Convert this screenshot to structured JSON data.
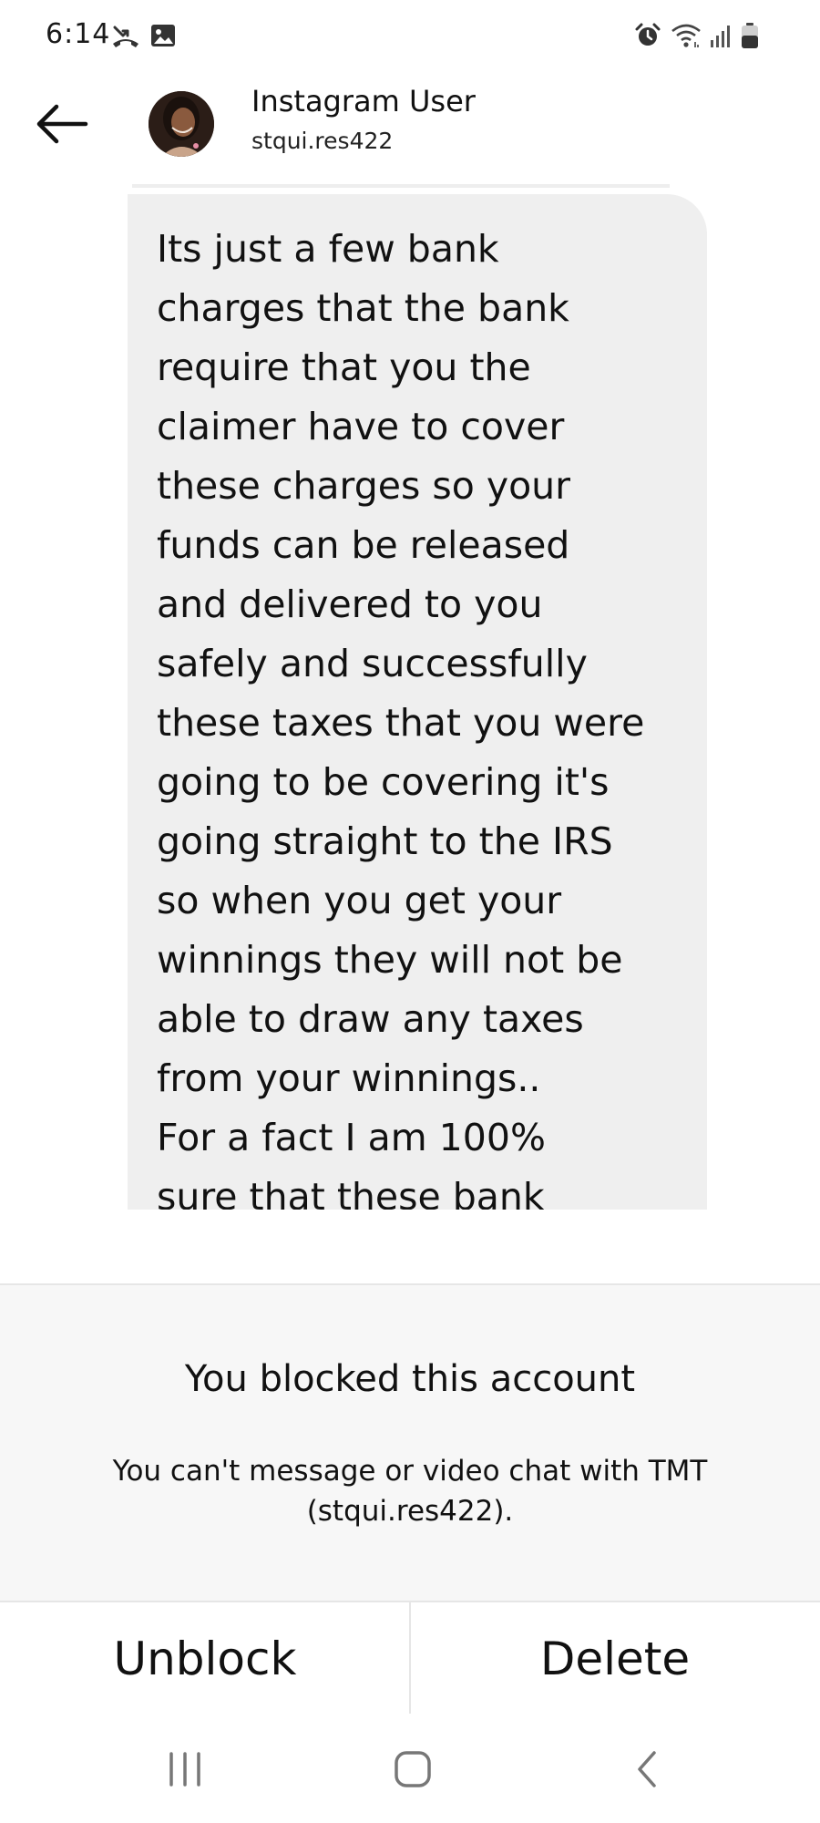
{
  "status_bar": {
    "time": "6:14",
    "icons": [
      "missed-call-icon",
      "gallery-icon",
      "alarm-icon",
      "wifi-icon",
      "signal-icon",
      "battery-icon"
    ]
  },
  "header": {
    "name": "Instagram User",
    "handle": "stqui.res422",
    "back_icon": "arrow-left-icon",
    "avatar": "profile-photo"
  },
  "message": {
    "text": "Its just a few bank\ncharges that the bank\nrequire that you the\nclaimer have to cover\nthese charges so your\nfunds can be released\nand delivered to you\nsafely and successfully\nthese taxes that you were\ngoing to be covering it's\ngoing straight to the IRS\nso when you get your\nwinnings they will not be\nable to draw any taxes\nfrom your winnings..\nFor a fact I am 100%\nsure that these bank"
  },
  "blocked": {
    "title": "You blocked this account",
    "description": "You can't message or video chat with TMT (stqui.res422)."
  },
  "actions": {
    "unblock_label": "Unblock",
    "delete_label": "Delete"
  },
  "nav_bar": {
    "icons": [
      "recent-apps-icon",
      "home-icon",
      "back-icon"
    ]
  },
  "colors": {
    "bubble_background": "#efefef",
    "panel_background": "#f7f7f7",
    "divider": "#e6e6e6",
    "text": "#111111"
  }
}
